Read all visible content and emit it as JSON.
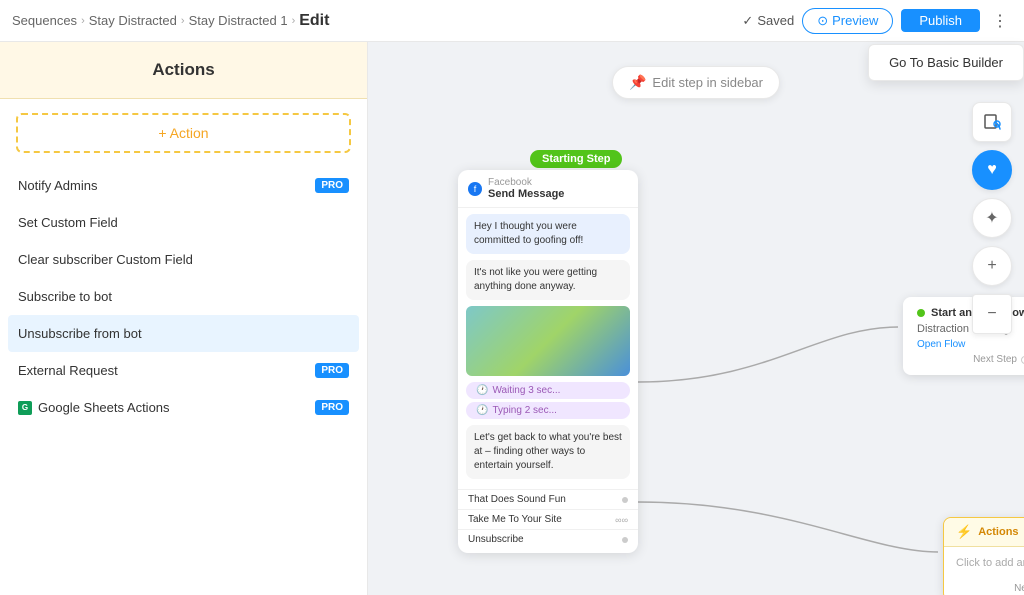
{
  "header": {
    "breadcrumb": [
      "Sequences",
      "Stay Distracted",
      "Stay Distracted 1"
    ],
    "page_title": "Edit",
    "saved_label": "Saved",
    "preview_label": "Preview",
    "publish_label": "Publish",
    "more_options_label": "⋮"
  },
  "tooltip": {
    "basic_builder_label": "Go To Basic Builder"
  },
  "sidebar": {
    "title": "Actions",
    "add_action_label": "+ Action",
    "items": [
      {
        "label": "Notify Admins",
        "pro": true,
        "icon": null
      },
      {
        "label": "Set Custom Field",
        "pro": false,
        "icon": null
      },
      {
        "label": "Clear subscriber Custom Field",
        "pro": false,
        "icon": null
      },
      {
        "label": "Subscribe to bot",
        "pro": false,
        "icon": null
      },
      {
        "label": "Unsubscribe from bot",
        "pro": false,
        "icon": null,
        "selected": true
      },
      {
        "label": "External Request",
        "pro": true,
        "icon": null
      },
      {
        "label": "Google Sheets Actions",
        "pro": true,
        "icon": "google-sheets"
      }
    ]
  },
  "canvas": {
    "edit_hint": "Edit step in sidebar",
    "starting_step_label": "Starting Step",
    "message_card": {
      "platform": "Facebook",
      "type": "Send Message",
      "bubbles": [
        "Hey I thought you were committed to goofing off!",
        "It's not like you were getting anything done anyway."
      ],
      "waiting_label": "Waiting 3 sec...",
      "typing_label": "Typing 2 sec...",
      "bottom_text": "Let's get back to what you're best at – finding other ways to entertain yourself.",
      "options": [
        {
          "label": "That Does Sound Fun",
          "chain": false
        },
        {
          "label": "Take Me To Your Site",
          "chain": true
        },
        {
          "label": "Unsubscribe",
          "chain": false
        }
      ]
    },
    "flow_node": {
      "header_label": "Start another Flow",
      "name": "Distraction Pathing",
      "open_flow_label": "Open Flow",
      "next_step_label": "Next Step"
    },
    "actions_node": {
      "header_label": "Actions",
      "body_label": "Click to add an action",
      "next_step_label": "Next Step"
    }
  },
  "toolbar": {
    "page_icon": "□+",
    "heart_icon": "♥",
    "sparkle_icon": "✦",
    "plus_icon": "+",
    "minus_icon": "−"
  }
}
